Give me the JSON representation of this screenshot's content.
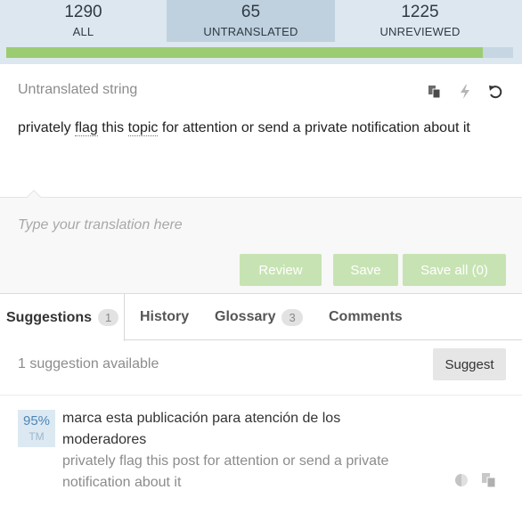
{
  "stats": {
    "all": {
      "count": "1290",
      "label": "ALL"
    },
    "untranslated": {
      "count": "65",
      "label": "UNTRANSLATED"
    },
    "unreviewed": {
      "count": "1225",
      "label": "UNREVIEWED"
    },
    "progress_fraction": 0.94
  },
  "source": {
    "label": "Untranslated string",
    "text_parts": [
      "privately ",
      "flag",
      " this ",
      "topic",
      " for attention or send a private notification about it"
    ],
    "tools": [
      "copy-icon",
      "lightning-icon",
      "undo-icon"
    ]
  },
  "editor": {
    "placeholder": "Type your translation here",
    "review_label": "Review",
    "save_label": "Save",
    "save_all_label": "Save all (0)"
  },
  "tabs": [
    {
      "label": "Suggestions",
      "badge": "1"
    },
    {
      "label": "History",
      "badge": ""
    },
    {
      "label": "Glossary",
      "badge": "3"
    },
    {
      "label": "Comments",
      "badge": ""
    }
  ],
  "suggestions": {
    "count_text": "1 suggestion available",
    "suggest_label": "Suggest",
    "items": [
      {
        "score": "95%",
        "kind": "TM",
        "target": "marca esta publicación para atención de los moderadores",
        "source": "privately flag this post for attention or send a private notification about it"
      }
    ]
  },
  "colors": {
    "header_bg": "#dde7ef",
    "active_tab_bg": "#bfd1de",
    "progress_green": "#9ccc72",
    "button_green_disabled": "#c7e3b3",
    "score_blue": "#4e86b6"
  }
}
